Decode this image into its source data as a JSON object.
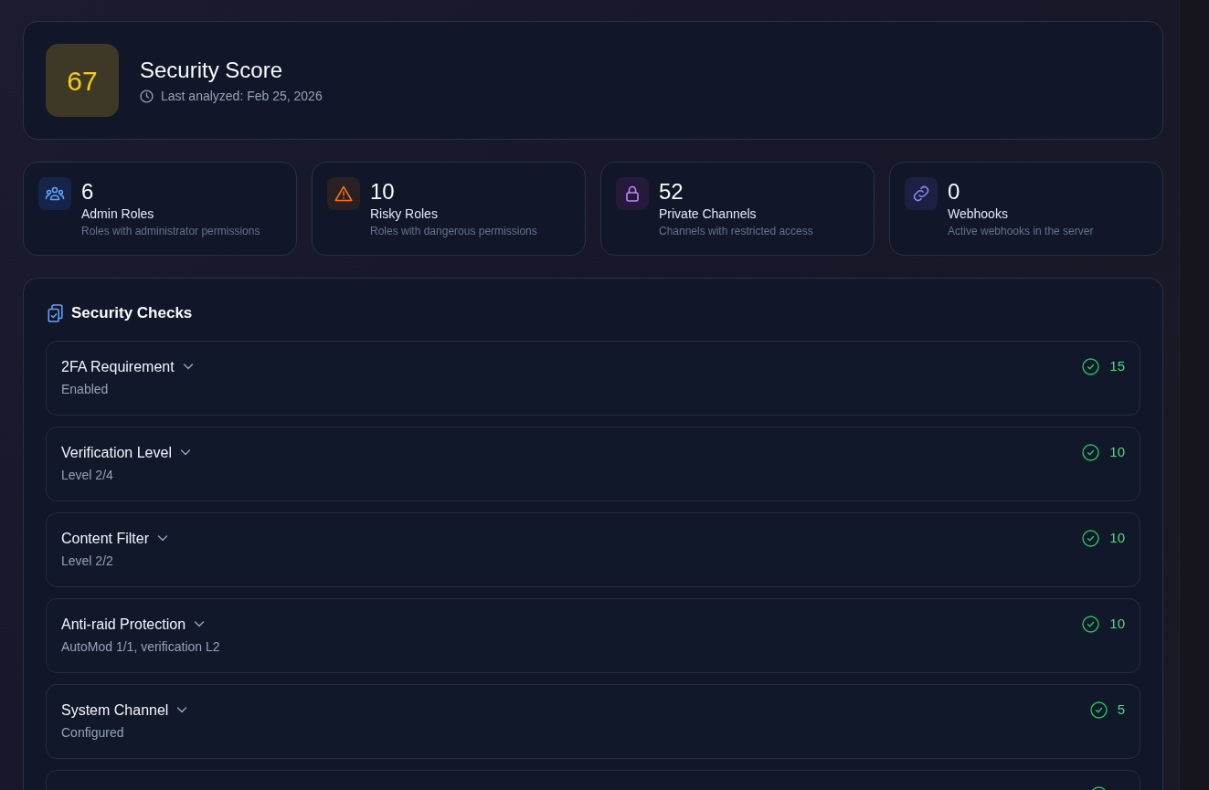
{
  "score": {
    "value": "67",
    "title": "Security Score",
    "last_analyzed": "Last analyzed: Feb 25, 2026"
  },
  "stats": [
    {
      "kind": "admins",
      "value": "6",
      "label": "Admin Roles",
      "description": "Roles with administrator permissions"
    },
    {
      "kind": "risky",
      "value": "10",
      "label": "Risky Roles",
      "description": "Roles with dangerous permissions"
    },
    {
      "kind": "private",
      "value": "52",
      "label": "Private Channels",
      "description": "Channels with restricted access"
    },
    {
      "kind": "webhooks",
      "value": "0",
      "label": "Webhooks",
      "description": "Active webhooks in the server"
    }
  ],
  "checks": {
    "title": "Security Checks",
    "items": [
      {
        "title": "2FA Requirement",
        "detail": "Enabled",
        "passed": true,
        "points": "15",
        "expanded": false
      },
      {
        "title": "Verification Level",
        "detail": "Level 2/4",
        "passed": true,
        "points": "10",
        "expanded": false
      },
      {
        "title": "Content Filter",
        "detail": "Level 2/2",
        "passed": true,
        "points": "10",
        "expanded": false
      },
      {
        "title": "Anti-raid Protection",
        "detail": "AutoMod 1/1, verification L2",
        "passed": true,
        "points": "10",
        "expanded": false
      },
      {
        "title": "System Channel",
        "detail": "Configured",
        "passed": true,
        "points": "5",
        "expanded": false
      },
      {
        "passed": true
      }
    ]
  }
}
